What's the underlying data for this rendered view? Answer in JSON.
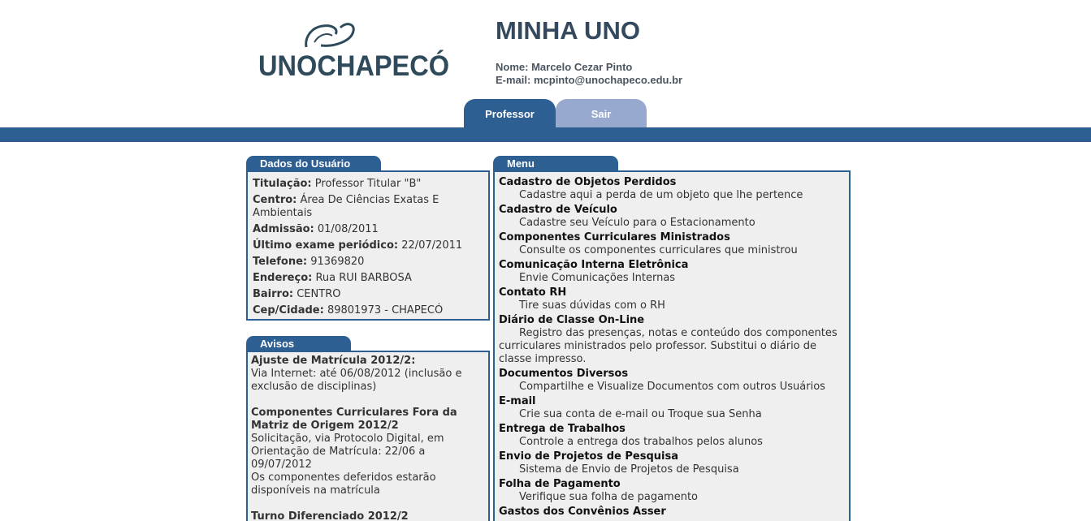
{
  "brand": {
    "logo_text": "UNOCHAPECÓ",
    "title": "MINHA UNO"
  },
  "user": {
    "name_label": "Nome:",
    "name": "Marcelo Cezar Pinto",
    "email_label": "E-mail:",
    "email": "mcpinto@unochapeco.edu.br"
  },
  "tabs": [
    {
      "label": "Professor",
      "active": true
    },
    {
      "label": "Sair",
      "active": false
    }
  ],
  "colors": {
    "primary": "#2e5f92",
    "tab_inactive": "#97a9cf",
    "panel_bg": "#efefef"
  },
  "dados": {
    "header": "Dados do Usuário",
    "rows": [
      {
        "label": "Titulação:",
        "value": "Professor Titular \"B\""
      },
      {
        "label": "Centro:",
        "value": "Área De Ciências Exatas E Ambientais"
      },
      {
        "label": "Admissão:",
        "value": "01/08/2011"
      },
      {
        "label": "Último exame periódico:",
        "value": "22/07/2011"
      },
      {
        "label": "Telefone:",
        "value": "91369820"
      },
      {
        "label": "Endereço:",
        "value": "Rua RUI BARBOSA"
      },
      {
        "label": "Bairro:",
        "value": "CENTRO"
      },
      {
        "label": "Cep/Cidade:",
        "value": "89801973 - CHAPECÓ"
      }
    ]
  },
  "avisos": {
    "header": "Avisos",
    "items": [
      {
        "title": "Ajuste de Matrícula 2012/2:",
        "lines": [
          "Via Internet: até 06/08/2012 (inclusão e exclusão de disciplinas)"
        ]
      },
      {
        "title": "Componentes Curriculares Fora da Matriz de Origem 2012/2",
        "lines": [
          "Solicitação, via Protocolo Digital, em Orientação de Matrícula: 22/06 a 09/07/2012",
          "Os componentes deferidos estarão disponíveis na matrícula"
        ]
      },
      {
        "title": "Turno Diferenciado 2012/2",
        "lines": []
      }
    ]
  },
  "menu": {
    "header": "Menu",
    "items": [
      {
        "title": "Cadastro de Objetos Perdidos",
        "desc": "Cadastre aqui a perda de um objeto que lhe pertence"
      },
      {
        "title": "Cadastro de Veículo",
        "desc": "Cadastre seu Veículo para o Estacionamento"
      },
      {
        "title": "Componentes Curriculares Ministrados",
        "desc": "Consulte os componentes curriculares que ministrou"
      },
      {
        "title": "Comunicação Interna Eletrônica",
        "desc": "Envie Comunicações Internas"
      },
      {
        "title": "Contato RH",
        "desc": "Tire suas dúvidas com o RH"
      },
      {
        "title": "Diário de Classe On-Line",
        "desc": "Registro das presenças, notas e conteúdo dos componentes curriculares ministrados pelo professor. Substitui o diário de classe impresso."
      },
      {
        "title": "Documentos Diversos",
        "desc": "Compartilhe e Visualize Documentos com outros Usuários"
      },
      {
        "title": "E-mail",
        "desc": "Crie sua conta de e-mail ou Troque sua Senha"
      },
      {
        "title": "Entrega de Trabalhos",
        "desc": "Controle a entrega dos trabalhos pelos alunos"
      },
      {
        "title": "Envio de Projetos de Pesquisa",
        "desc": "Sistema de Envio de Projetos de Pesquisa"
      },
      {
        "title": "Folha de Pagamento",
        "desc": "Verifique sua folha de pagamento"
      },
      {
        "title": "Gastos dos Convênios Asser",
        "desc": ""
      }
    ]
  }
}
